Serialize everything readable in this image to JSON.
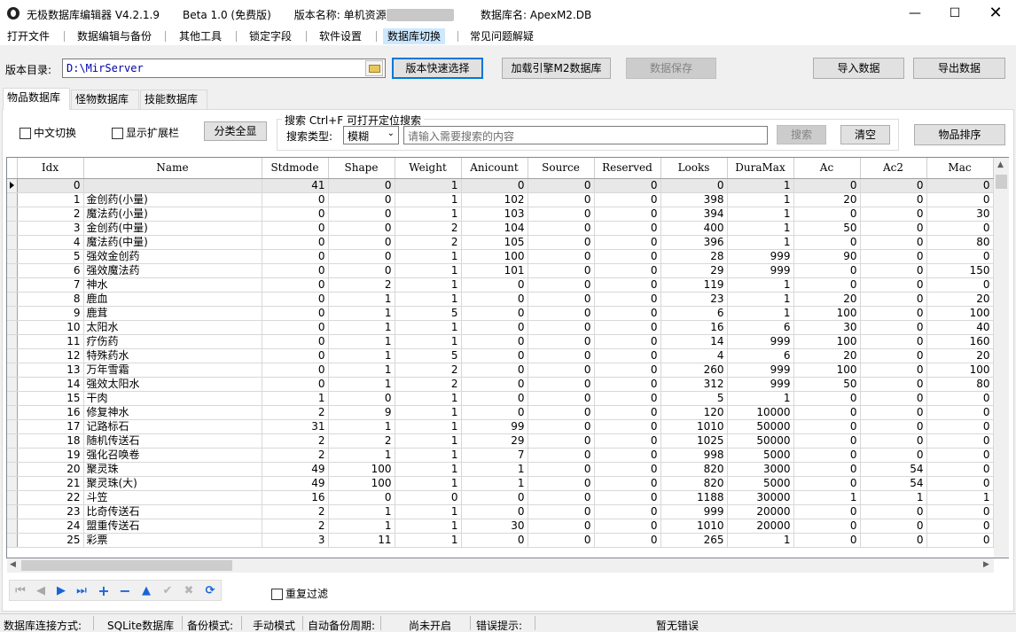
{
  "window": {
    "title": "无极数据库编辑器 V4.2.1.9",
    "edition": "Beta 1.0 (免费版)",
    "version_label": "版本名称: 单机资源",
    "version_blurred": "7400000750",
    "db_name_label": "数据库名: ApexM2.DB",
    "minimize": "—",
    "maximize": "☐",
    "close": "✕"
  },
  "menu": [
    "打开文件",
    "数据编辑与备份",
    "其他工具",
    "锁定字段",
    "软件设置",
    "数据库切换",
    "常见问题解疑"
  ],
  "toolbar": {
    "dir_label": "版本目录:",
    "dir_value": "D:\\MirServer",
    "quick_select": "版本快速选择",
    "load_engine": "加载引擎M2数据库",
    "save": "数据保存",
    "import": "导入数据",
    "export": "导出数据"
  },
  "tabs": [
    "物品数据库",
    "怪物数据库",
    "技能数据库"
  ],
  "filter": {
    "chinese_toggle": "中文切换",
    "show_ext": "显示扩展栏",
    "show_all": "分类全显",
    "search_legend": "搜索  Ctrl+F 可打开定位搜索",
    "search_type_label": "搜索类型:",
    "search_type_value": "模糊",
    "search_placeholder": "请输入需要搜索的内容",
    "search_btn": "搜索",
    "clear_btn": "清空",
    "sort_btn": "物品排序"
  },
  "grid": {
    "columns": [
      "Idx",
      "Name",
      "Stdmode",
      "Shape",
      "Weight",
      "Anicount",
      "Source",
      "Reserved",
      "Looks",
      "DuraMax",
      "Ac",
      "Ac2",
      "Mac"
    ],
    "rows": [
      [
        "0",
        "",
        "41",
        "0",
        "1",
        "0",
        "0",
        "0",
        "0",
        "1",
        "0",
        "0",
        "0"
      ],
      [
        "1",
        "金创药(小量)",
        "0",
        "0",
        "1",
        "102",
        "0",
        "0",
        "398",
        "1",
        "20",
        "0",
        "0"
      ],
      [
        "2",
        "魔法药(小量)",
        "0",
        "0",
        "1",
        "103",
        "0",
        "0",
        "394",
        "1",
        "0",
        "0",
        "30"
      ],
      [
        "3",
        "金创药(中量)",
        "0",
        "0",
        "2",
        "104",
        "0",
        "0",
        "400",
        "1",
        "50",
        "0",
        "0"
      ],
      [
        "4",
        "魔法药(中量)",
        "0",
        "0",
        "2",
        "105",
        "0",
        "0",
        "396",
        "1",
        "0",
        "0",
        "80"
      ],
      [
        "5",
        "强效金创药",
        "0",
        "0",
        "1",
        "100",
        "0",
        "0",
        "28",
        "999",
        "90",
        "0",
        "0"
      ],
      [
        "6",
        "强效魔法药",
        "0",
        "0",
        "1",
        "101",
        "0",
        "0",
        "29",
        "999",
        "0",
        "0",
        "150"
      ],
      [
        "7",
        "神水",
        "0",
        "2",
        "1",
        "0",
        "0",
        "0",
        "119",
        "1",
        "0",
        "0",
        "0"
      ],
      [
        "8",
        "鹿血",
        "0",
        "1",
        "1",
        "0",
        "0",
        "0",
        "23",
        "1",
        "20",
        "0",
        "20"
      ],
      [
        "9",
        "鹿茸",
        "0",
        "1",
        "5",
        "0",
        "0",
        "0",
        "6",
        "1",
        "100",
        "0",
        "100"
      ],
      [
        "10",
        "太阳水",
        "0",
        "1",
        "1",
        "0",
        "0",
        "0",
        "16",
        "6",
        "30",
        "0",
        "40"
      ],
      [
        "11",
        "疗伤药",
        "0",
        "1",
        "1",
        "0",
        "0",
        "0",
        "14",
        "999",
        "100",
        "0",
        "160"
      ],
      [
        "12",
        "特殊药水",
        "0",
        "1",
        "5",
        "0",
        "0",
        "0",
        "4",
        "6",
        "20",
        "0",
        "20"
      ],
      [
        "13",
        "万年雪霜",
        "0",
        "1",
        "2",
        "0",
        "0",
        "0",
        "260",
        "999",
        "100",
        "0",
        "100"
      ],
      [
        "14",
        "强效太阳水",
        "0",
        "1",
        "2",
        "0",
        "0",
        "0",
        "312",
        "999",
        "50",
        "0",
        "80"
      ],
      [
        "15",
        "干肉",
        "1",
        "0",
        "1",
        "0",
        "0",
        "0",
        "5",
        "1",
        "0",
        "0",
        "0"
      ],
      [
        "16",
        "修复神水",
        "2",
        "9",
        "1",
        "0",
        "0",
        "0",
        "120",
        "10000",
        "0",
        "0",
        "0"
      ],
      [
        "17",
        "记路标石",
        "31",
        "1",
        "1",
        "99",
        "0",
        "0",
        "1010",
        "50000",
        "0",
        "0",
        "0"
      ],
      [
        "18",
        "随机传送石",
        "2",
        "2",
        "1",
        "29",
        "0",
        "0",
        "1025",
        "50000",
        "0",
        "0",
        "0"
      ],
      [
        "19",
        "强化召唤卷",
        "2",
        "1",
        "1",
        "7",
        "0",
        "0",
        "998",
        "5000",
        "0",
        "0",
        "0"
      ],
      [
        "20",
        "聚灵珠",
        "49",
        "100",
        "1",
        "1",
        "0",
        "0",
        "820",
        "3000",
        "0",
        "54",
        "0"
      ],
      [
        "21",
        "聚灵珠(大)",
        "49",
        "100",
        "1",
        "1",
        "0",
        "0",
        "820",
        "5000",
        "0",
        "54",
        "0"
      ],
      [
        "22",
        "斗笠",
        "16",
        "0",
        "0",
        "0",
        "0",
        "0",
        "1188",
        "30000",
        "1",
        "1",
        "1"
      ],
      [
        "23",
        "比奇传送石",
        "2",
        "1",
        "1",
        "0",
        "0",
        "0",
        "999",
        "20000",
        "0",
        "0",
        "0"
      ],
      [
        "24",
        "盟重传送石",
        "2",
        "1",
        "1",
        "30",
        "0",
        "0",
        "1010",
        "20000",
        "0",
        "0",
        "0"
      ],
      [
        "25",
        "彩票",
        "3",
        "11",
        "1",
        "0",
        "0",
        "0",
        "265",
        "1",
        "0",
        "0",
        "0"
      ]
    ]
  },
  "navigator": {
    "first": "⏮",
    "prior": "◀",
    "next": "▶",
    "last": "⏭",
    "insert": "+",
    "delete": "−",
    "edit": "▲",
    "post": "✔",
    "cancel": "✖",
    "refresh": "⟳"
  },
  "repeat_filter": "重复过滤",
  "status": {
    "conn_label": "数据库连接方式:",
    "conn_value": "SQLite数据库",
    "backup_label": "备份模式:",
    "backup_value": "手动模式",
    "auto_label": "自动备份周期:",
    "auto_value": "尚未开启",
    "error_label": "错误提示:",
    "error_value": "暂无错误"
  },
  "colors": {
    "accent": "#0078d7",
    "menu_active": "#cce8ff",
    "path_text": "#0000aa",
    "nav_icon": "#1565d8"
  }
}
